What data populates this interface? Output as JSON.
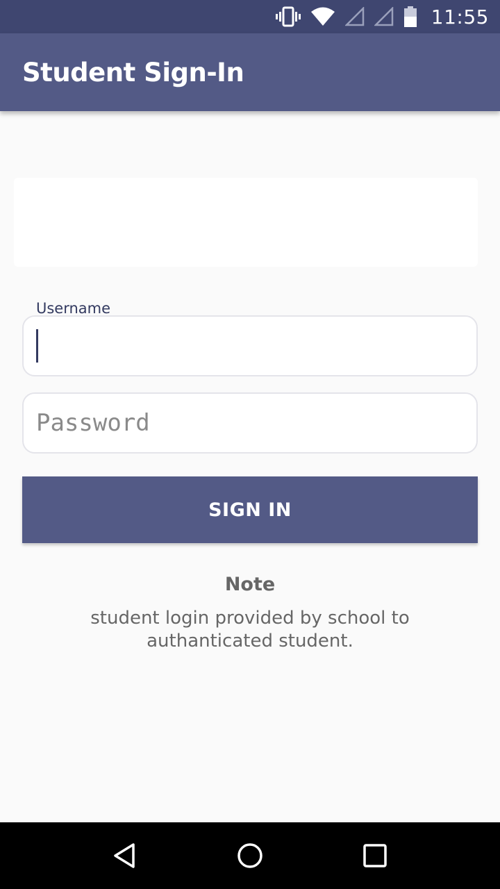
{
  "status_bar": {
    "time": "11:55",
    "icons": [
      "vibrate-icon",
      "wifi-icon",
      "signal-icon",
      "signal-icon",
      "battery-icon"
    ]
  },
  "app_bar": {
    "title": "Student Sign-In"
  },
  "form": {
    "username_label": "Username",
    "username_value": "",
    "password_placeholder": "Password",
    "password_value": "",
    "sign_in_label": "SIGN IN"
  },
  "note": {
    "title": "Note",
    "text": "student login provided by school to authanticated student."
  },
  "nav_bar": {
    "icons": [
      "back-icon",
      "home-icon",
      "recents-icon"
    ]
  },
  "colors": {
    "status_bar": "#3f4670",
    "primary": "#535a86",
    "background": "#fafafa",
    "note_text": "#666666"
  }
}
